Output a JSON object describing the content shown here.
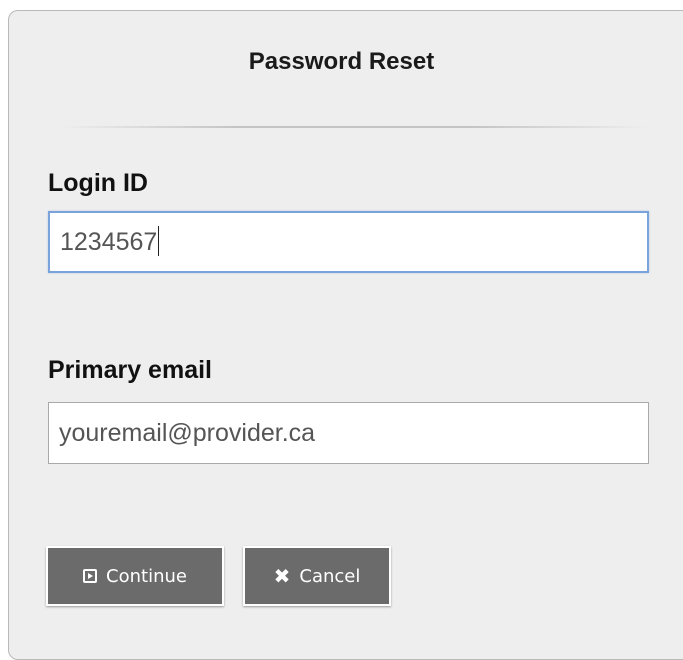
{
  "dialog": {
    "title": "Password Reset"
  },
  "login": {
    "label": "Login ID",
    "value": "1234567"
  },
  "email": {
    "label": "Primary email",
    "value": "youremail@provider.ca"
  },
  "buttons": {
    "continue_label": "Continue",
    "continue_icon": "play-square-icon",
    "cancel_label": "Cancel",
    "cancel_icon": "close-icon"
  },
  "colors": {
    "panel_background": "#eeeeee",
    "button_background": "#6b6b6b",
    "focus_border": "#7aa3dc"
  }
}
